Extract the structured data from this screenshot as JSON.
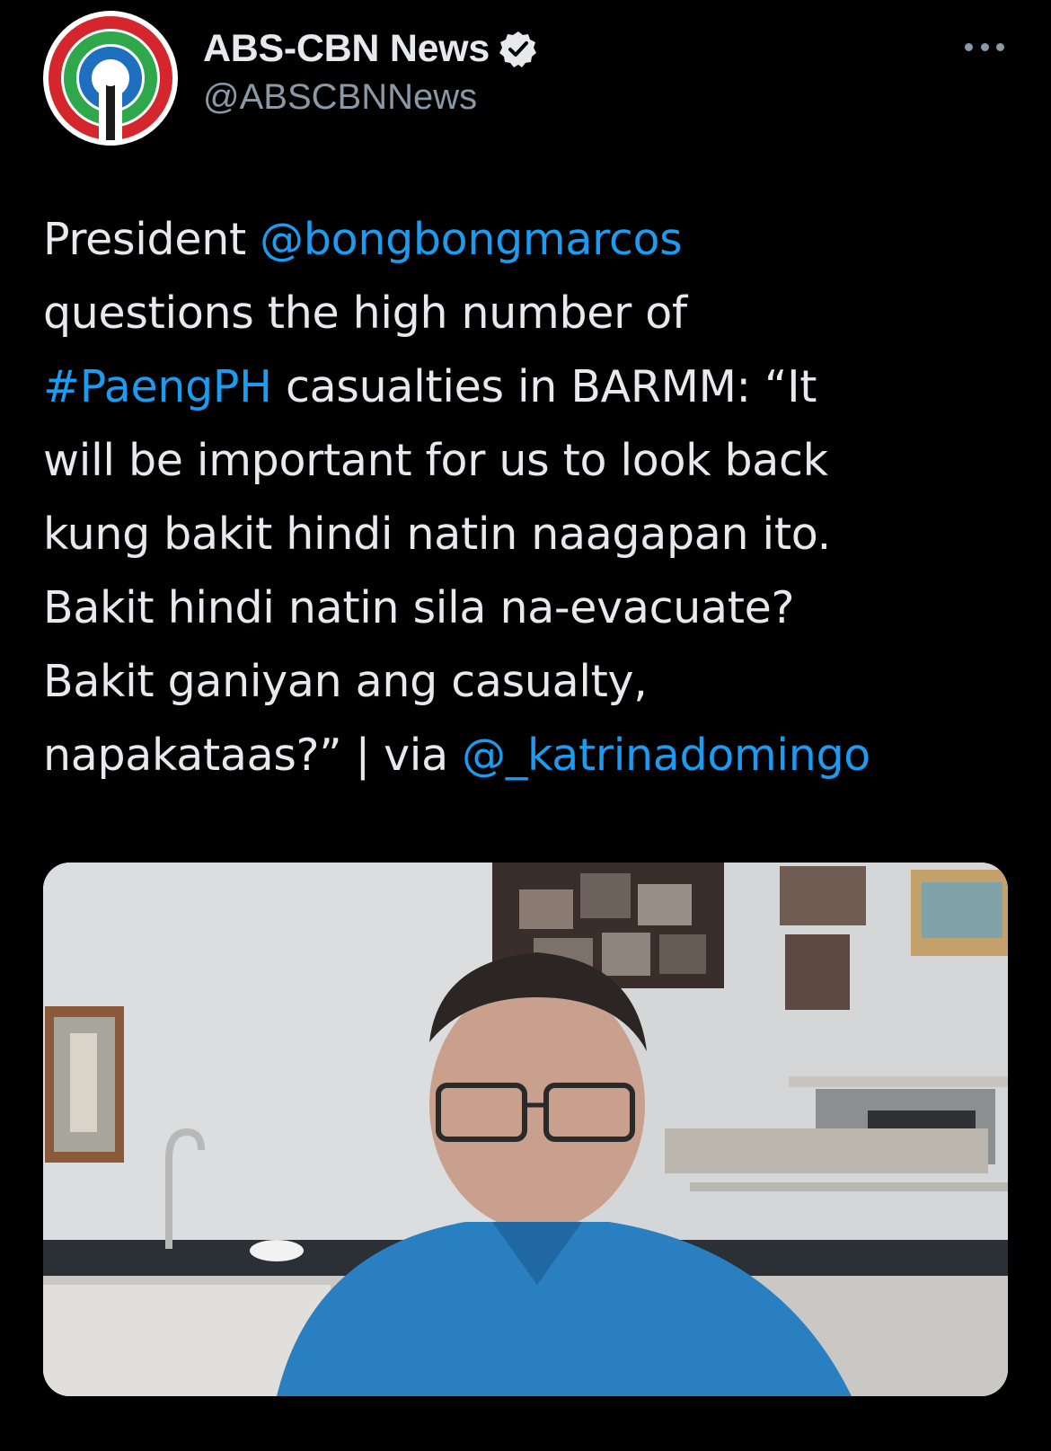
{
  "account": {
    "display_name": "ABS-CBN News",
    "handle": "@ABSCBNNews",
    "verified": true,
    "avatar_icon": "abs-cbn-logo-icon"
  },
  "tweet": {
    "lines": [
      [
        {
          "text": "President ",
          "type": "text"
        },
        {
          "text": "@bongbongmarcos",
          "type": "mention"
        }
      ],
      [
        {
          "text": "questions the high number of",
          "type": "text"
        }
      ],
      [
        {
          "text": "#PaengPH",
          "type": "hashtag"
        },
        {
          "text": " casualties in BARMM: “It",
          "type": "text"
        }
      ],
      [
        {
          "text": "will be important for us to look back",
          "type": "text"
        }
      ],
      [
        {
          "text": "kung bakit hindi natin naagapan ito.",
          "type": "text"
        }
      ],
      [
        {
          "text": "Bakit hindi natin sila na-evacuate?",
          "type": "text"
        }
      ],
      [
        {
          "text": "Bakit ganiyan ang casualty,",
          "type": "text"
        }
      ],
      [
        {
          "text": "napakataas?” | via ",
          "type": "text"
        },
        {
          "text": "@_katrinadomingo",
          "type": "mention"
        }
      ]
    ]
  },
  "media": {
    "kind": "video-still"
  },
  "colors": {
    "background": "#000000",
    "text": "#e7e9ea",
    "secondary": "#8b98a5",
    "link": "#1d9bf0",
    "logo_red": "#d6262d",
    "logo_green": "#2ea84a",
    "logo_blue": "#1f6fc0"
  }
}
